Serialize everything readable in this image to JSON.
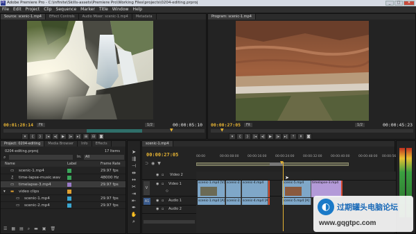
{
  "window": {
    "title": "Adobe Premiere Pro - C:\\infinite\\Skills-assets\\Premiere Pro\\Working Files\\projects\\0204-editing.prproj",
    "app_icon": "Pr",
    "min": "_",
    "max": "□",
    "close": "✕"
  },
  "menu": [
    "File",
    "Edit",
    "Project",
    "Clip",
    "Sequence",
    "Marker",
    "Title",
    "Window",
    "Help"
  ],
  "source_monitor": {
    "tabs": [
      "Source: scenic-1.mp4",
      "Effect Controls",
      "Audio Mixer: scenic-1.mp4",
      "Metadata"
    ],
    "timecode_in": "00:01:28:14",
    "fit": "Fit",
    "resolution": "1/2",
    "duration": "00:00:05:10"
  },
  "program_monitor": {
    "tab": "Program: scenic-1.mp4",
    "timecode_in": "00:00:27:05",
    "fit": "Fit",
    "resolution": "1/2",
    "duration": "00:00:45:23"
  },
  "project_panel": {
    "tabs": [
      "Project: 0204-editing",
      "Media Browser",
      "Info",
      "Effects"
    ],
    "filename": "0204-editing.prproj",
    "item_count": "17 Items",
    "in_label": "In:",
    "in_value": "All",
    "columns": [
      "Name",
      "Label",
      "Frame Rate"
    ],
    "rows": [
      {
        "name": "scenic-1.mp4",
        "label_color": "#3aa65a",
        "rate": "29.97 fps"
      },
      {
        "name": "time-lapse-music.wav",
        "label_color": "#3aa65a",
        "rate": "48000 Hz"
      },
      {
        "name": "timelapse-3.mp4",
        "label_color": "#9a7ac8",
        "rate": "29.97 fps"
      },
      {
        "name": "video clips",
        "label_color": "#e0a030",
        "rate": ""
      },
      {
        "name": "scenic-1.mp4",
        "label_color": "#3aa6d0",
        "rate": "29.97 fps"
      },
      {
        "name": "scenic-2.mp4",
        "label_color": "#3aa6d0",
        "rate": "29.97 fps"
      }
    ]
  },
  "timeline": {
    "tab": "scenic-1.mp4",
    "timecode": "00:00:27:05",
    "ruler": [
      "00:00",
      "00:00:08:00",
      "00:00:16:00",
      "00:00:24:00",
      "00:00:32:00",
      "00:00:40:00",
      "00:00:48:00",
      "00:00:56:00"
    ],
    "tracks": [
      {
        "id": "",
        "name": "Video 2"
      },
      {
        "id": "V",
        "name": "Video 1"
      },
      {
        "id": "A1",
        "name": "Audio 1"
      },
      {
        "id": "",
        "name": "Audio 2"
      }
    ],
    "video_clips": [
      {
        "label": "scenic-1.mp4 [V]"
      },
      {
        "label": "scenic-2.j"
      },
      {
        "label": "scenic-4.mp4"
      },
      {
        "label": "scenic-5.mp4"
      },
      {
        "label": "timelapse-3.mp4"
      }
    ],
    "audio_clips": [
      {
        "label": "scenic-1.mp4 [A]"
      },
      {
        "label": "scenic-2."
      },
      {
        "label": "scenic-4.mp4 [A]"
      },
      {
        "label": "scenic-5.mp4 [A]"
      }
    ]
  },
  "watermark": {
    "title": "过期罐头电脑论坛",
    "url": "www.gqgtpc.com"
  },
  "colors": {
    "timecode": "#e8b534",
    "video_clip": "#7fa7c8",
    "purple_clip": "#b39ad8",
    "audio_clip": "#7fa7c8",
    "playhead": "#d94b2f"
  }
}
